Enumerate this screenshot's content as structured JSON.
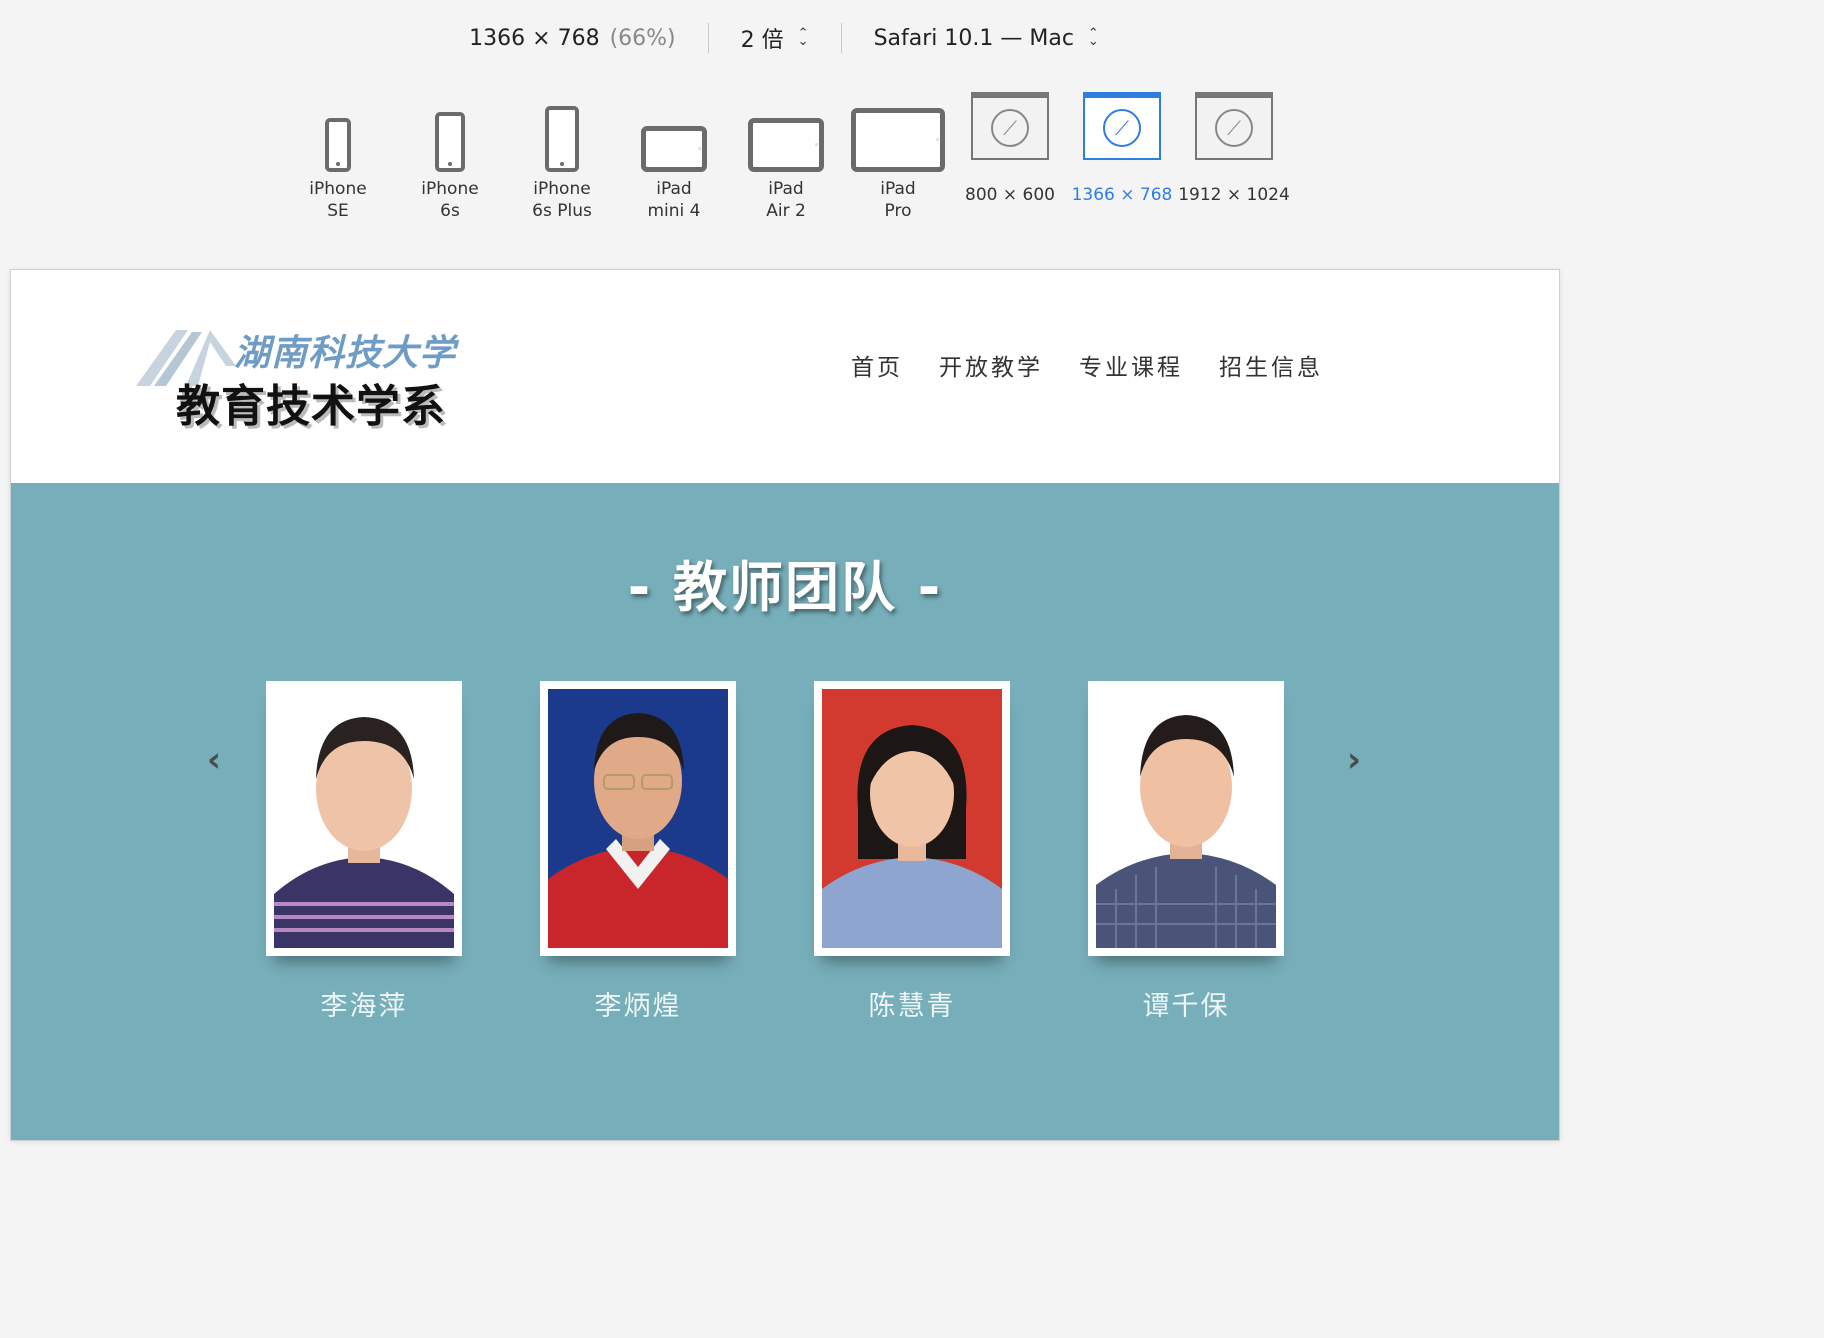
{
  "toolbar": {
    "resolution": "1366 × 768",
    "zoom_percent": "(66%)",
    "pixel_ratio": "2 倍",
    "user_agent": "Safari 10.1 — Mac",
    "presets": [
      {
        "label": "iPhone\nSE",
        "kind": "phone",
        "selected": false
      },
      {
        "label": "iPhone\n6s",
        "kind": "phone",
        "selected": false
      },
      {
        "label": "iPhone\n6s Plus",
        "kind": "phone",
        "selected": false
      },
      {
        "label": "iPad\nmini 4",
        "kind": "tablet",
        "selected": false
      },
      {
        "label": "iPad\nAir 2",
        "kind": "tablet",
        "selected": false
      },
      {
        "label": "iPad\nPro",
        "kind": "tablet",
        "selected": false
      },
      {
        "label": "800 × 600",
        "kind": "browser",
        "selected": false
      },
      {
        "label": "1366 × 768",
        "kind": "browser",
        "selected": true
      },
      {
        "label": "1912 × 1024",
        "kind": "browser",
        "selected": false
      }
    ],
    "accent_color": "#2f7de1"
  },
  "site": {
    "logo": {
      "university": "湖南科技大学",
      "department": "教育技术学系"
    },
    "nav": [
      "首页",
      "开放教学",
      "专业课程",
      "招生信息"
    ],
    "section_title": "- 教师团队 -",
    "section_bg_color": "#76aeb9",
    "teachers": [
      {
        "name": "李海萍",
        "photo_bg": "#ffffff",
        "shirt": "#3a3566"
      },
      {
        "name": "李炳煌",
        "photo_bg": "#1b3a8c",
        "shirt": "#c8262a"
      },
      {
        "name": "陈慧青",
        "photo_bg": "#d23a2f",
        "shirt": "#8ea6cf"
      },
      {
        "name": "谭千保",
        "photo_bg": "#ffffff",
        "shirt": "#4a5478"
      }
    ]
  }
}
